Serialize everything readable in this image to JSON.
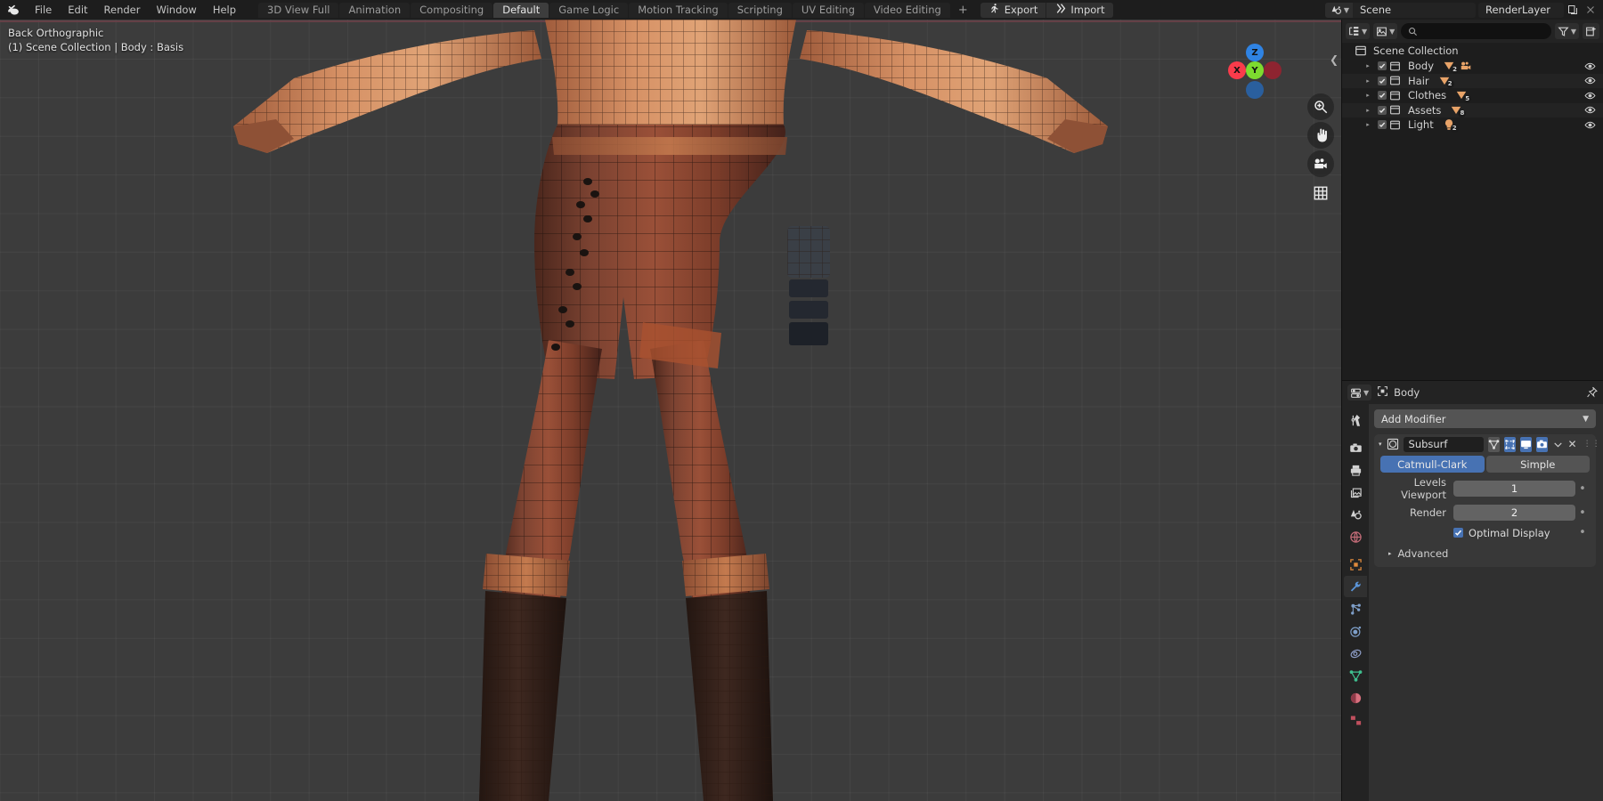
{
  "topbar": {
    "logo": "blender-logo",
    "menus": [
      "File",
      "Edit",
      "Render",
      "Window",
      "Help"
    ],
    "workspaces": [
      {
        "label": "3D View Full",
        "active": false
      },
      {
        "label": "Animation",
        "active": false
      },
      {
        "label": "Compositing",
        "active": false
      },
      {
        "label": "Default",
        "active": true
      },
      {
        "label": "Game Logic",
        "active": false
      },
      {
        "label": "Motion Tracking",
        "active": false
      },
      {
        "label": "Scripting",
        "active": false
      },
      {
        "label": "UV Editing",
        "active": false
      },
      {
        "label": "Video Editing",
        "active": false
      }
    ],
    "add_workspace": "+",
    "addons": [
      {
        "label": "Export",
        "icon": "export-running-icon"
      },
      {
        "label": "Import",
        "icon": "import-arrow-icon"
      }
    ],
    "scene_name": "Scene",
    "render_layer_name": "RenderLayer",
    "scene_icon": "scene-icon",
    "new_layer_icon": "copy-icon",
    "remove_layer_icon": "close-x-icon"
  },
  "viewport": {
    "view_name": "Back Orthographic",
    "object_info": "(1) Scene Collection | Body : Basis",
    "collapse_arrow": "chevron-left-icon",
    "gizmo": {
      "x_label": "X",
      "y_label": "Y",
      "z_label": "Z",
      "x_color": "#fa3b4b",
      "y_color": "#7ddb2f",
      "z_color": "#2f83e3"
    },
    "tools": [
      {
        "name": "zoom-icon"
      },
      {
        "name": "hand-pan-icon"
      },
      {
        "name": "camera-icon"
      },
      {
        "name": "grid-icon"
      }
    ],
    "background_color": "#3c3c3c",
    "horizon_color": "#6b4048",
    "z_axis_color": "#4a7fb5"
  },
  "outliner": {
    "header": {
      "display_mode_icon": "outliner-display-mode-icon",
      "filter_id_icon": "image-id-icon",
      "search_placeholder": "",
      "search_value": "",
      "search_icon": "search-icon",
      "filter_icon": "funnel-filter-icon",
      "new_collection_icon": "new-collection-icon"
    },
    "scene_collection": {
      "label": "Scene Collection",
      "icon": "collection-icon"
    },
    "rows": [
      {
        "label": "Body",
        "checked": true,
        "expand": "▸",
        "badges": [
          {
            "icon": "mesh-data-icon",
            "count": "2"
          },
          {
            "icon": "camera-data-icon",
            "count": ""
          }
        ],
        "visible": true
      },
      {
        "label": "Hair",
        "checked": true,
        "expand": "▸",
        "badges": [
          {
            "icon": "mesh-data-icon",
            "count": "2"
          }
        ],
        "visible": true
      },
      {
        "label": "Clothes",
        "checked": true,
        "expand": "▸",
        "badges": [
          {
            "icon": "mesh-data-icon",
            "count": "5"
          }
        ],
        "visible": true
      },
      {
        "label": "Assets",
        "checked": true,
        "expand": "▸",
        "badges": [
          {
            "icon": "mesh-data-icon",
            "count": "8"
          }
        ],
        "visible": true
      },
      {
        "label": "Light",
        "checked": true,
        "expand": "▸",
        "badges": [
          {
            "icon": "light-data-icon",
            "count": "2"
          }
        ],
        "visible": true
      }
    ]
  },
  "properties": {
    "header": {
      "editor_icon": "properties-editor-icon",
      "object_icon": "object-data-icon",
      "object_name": "Body",
      "pin_icon": "pin-icon"
    },
    "tabs": [
      {
        "name": "tool",
        "icon": "tool-wrench-screwdriver-icon",
        "active": false
      },
      {
        "name": "render",
        "icon": "render-camera-back-icon",
        "active": false
      },
      {
        "name": "output",
        "icon": "output-printer-icon",
        "active": false
      },
      {
        "name": "view-layer",
        "icon": "view-layer-images-icon",
        "active": false
      },
      {
        "name": "scene",
        "icon": "scene-cone-icon",
        "active": false
      },
      {
        "name": "world",
        "icon": "world-globe-icon",
        "active": false
      },
      {
        "name": "object",
        "icon": "object-square-icon",
        "active": false
      },
      {
        "name": "modifiers",
        "icon": "modifier-wrench-icon",
        "active": true
      },
      {
        "name": "particles",
        "icon": "particles-icon",
        "active": false
      },
      {
        "name": "physics",
        "icon": "physics-orbit-icon",
        "active": false
      },
      {
        "name": "constraints",
        "icon": "constraints-icon",
        "active": false
      },
      {
        "name": "object-data",
        "icon": "mesh-data-triangle-icon",
        "active": false
      },
      {
        "name": "material",
        "icon": "material-sphere-icon",
        "active": false
      },
      {
        "name": "texture",
        "icon": "texture-checker-icon",
        "active": false
      }
    ],
    "add_modifier_label": "Add Modifier",
    "add_modifier_chevron": "chevron-down-icon",
    "modifier": {
      "expand_arrow": "▾",
      "type_icon": "subsurf-modifier-icon",
      "name": "Subsurf",
      "toggles": [
        {
          "name": "on-cage-toggle",
          "icon": "triangle-vertex-icon",
          "on": false
        },
        {
          "name": "edit-mode-toggle",
          "icon": "edit-mode-icon",
          "on": true
        },
        {
          "name": "realtime-toggle",
          "icon": "display-monitor-icon",
          "on": true
        },
        {
          "name": "render-toggle",
          "icon": "render-camera-icon",
          "on": true
        }
      ],
      "extras_chevron": "chevron-down-icon",
      "delete_icon": "close-x-icon",
      "grip_icon": "drag-grip-icon",
      "subdivision_types": [
        {
          "label": "Catmull-Clark",
          "active": true
        },
        {
          "label": "Simple",
          "active": false
        }
      ],
      "fields": [
        {
          "label": "Levels Viewport",
          "value": "1"
        },
        {
          "label": "Render",
          "value": "2"
        }
      ],
      "optimal_display": {
        "label": "Optimal Display",
        "checked": true
      },
      "advanced": {
        "label": "Advanced",
        "arrow": "▸"
      }
    }
  },
  "colors": {
    "accent_blue": "#4772b3",
    "panel_bg": "#303030",
    "editor_bg": "#1d1d1d",
    "header_bg": "#232323",
    "viewport_bg": "#3c3c3c",
    "text": "#dcdcdc",
    "outliner_orange": "#e8a368"
  }
}
